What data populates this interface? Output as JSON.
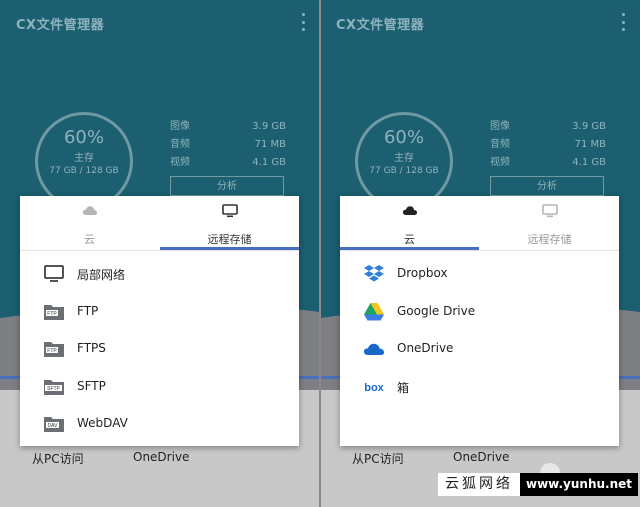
{
  "colors": {
    "teal": "#1b5f70",
    "accent_blue": "#4a6fbf",
    "dialog_bg": "#ffffff"
  },
  "panels": [
    {
      "app_title": "CX文件管理器",
      "storage": {
        "percent": "60%",
        "label": "主存",
        "capacity": "77 GB / 128 GB"
      },
      "stats": [
        {
          "name": "图像",
          "size": "3.9 GB"
        },
        {
          "name": "音频",
          "size": "71 MB"
        },
        {
          "name": "视频",
          "size": "4.1 GB"
        }
      ],
      "analyze_label": "分析",
      "bottom": {
        "left": "从PC访问",
        "right": "OneDrive"
      },
      "dialog": {
        "tabs": [
          {
            "label": "云",
            "icon": "cloud-icon",
            "active": false
          },
          {
            "label": "远程存储",
            "icon": "monitor-icon",
            "active": true
          }
        ],
        "items": [
          {
            "label": "局部网络",
            "icon": "monitor-icon"
          },
          {
            "label": "FTP",
            "icon": "ftp-folder-icon"
          },
          {
            "label": "FTPS",
            "icon": "ftps-folder-icon"
          },
          {
            "label": "SFTP",
            "icon": "sftp-folder-icon"
          },
          {
            "label": "WebDAV",
            "icon": "webdav-folder-icon"
          }
        ]
      }
    },
    {
      "app_title": "CX文件管理器",
      "storage": {
        "percent": "60%",
        "label": "主存",
        "capacity": "77 GB / 128 GB"
      },
      "stats": [
        {
          "name": "图像",
          "size": "3.9 GB"
        },
        {
          "name": "音频",
          "size": "71 MB"
        },
        {
          "name": "视频",
          "size": "4.1 GB"
        }
      ],
      "analyze_label": "分析",
      "bottom": {
        "left": "从PC访问",
        "right": "OneDrive"
      },
      "dialog": {
        "tabs": [
          {
            "label": "云",
            "icon": "cloud-icon",
            "active": true
          },
          {
            "label": "远程存储",
            "icon": "monitor-icon",
            "active": false
          }
        ],
        "items": [
          {
            "label": "Dropbox",
            "icon": "dropbox-icon"
          },
          {
            "label": "Google Drive",
            "icon": "google-drive-icon"
          },
          {
            "label": "OneDrive",
            "icon": "onedrive-icon"
          },
          {
            "label": "箱",
            "icon": "box-icon"
          }
        ]
      }
    }
  ],
  "watermark": {
    "left_text": "云狐网络",
    "right_text": "www.yunhu.net"
  }
}
